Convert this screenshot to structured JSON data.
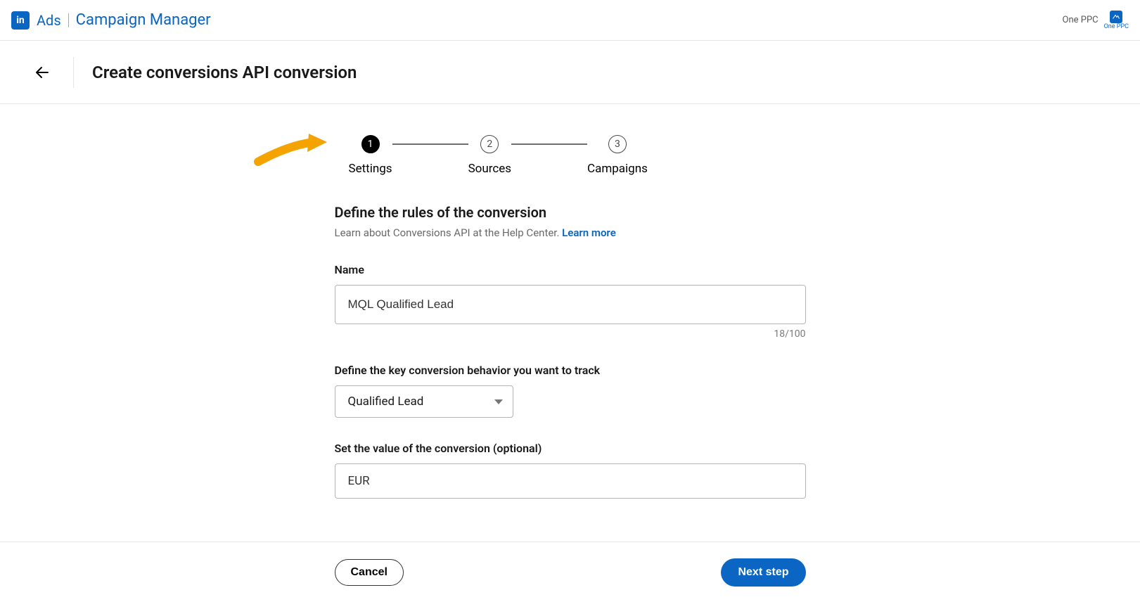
{
  "topbar": {
    "ads_label": "Ads",
    "cm_label": "Campaign Manager",
    "org_name": "One PPC",
    "org_sub": "One PPC"
  },
  "subheader": {
    "page_title": "Create conversions API conversion"
  },
  "stepper": {
    "steps": [
      {
        "num": "1",
        "label": "Settings"
      },
      {
        "num": "2",
        "label": "Sources"
      },
      {
        "num": "3",
        "label": "Campaigns"
      }
    ]
  },
  "section": {
    "title": "Define the rules of the conversion",
    "subtitle": "Learn about Conversions API at the Help Center. ",
    "learn_more": "Learn more"
  },
  "fields": {
    "name_label": "Name",
    "name_value": "MQL Qualified Lead",
    "name_count": "18/100",
    "behavior_label": "Define the key conversion behavior you want to track",
    "behavior_value": "Qualified Lead",
    "value_label": "Set the value of the conversion (optional)",
    "value_currency": "EUR"
  },
  "footer": {
    "cancel": "Cancel",
    "next": "Next step"
  }
}
